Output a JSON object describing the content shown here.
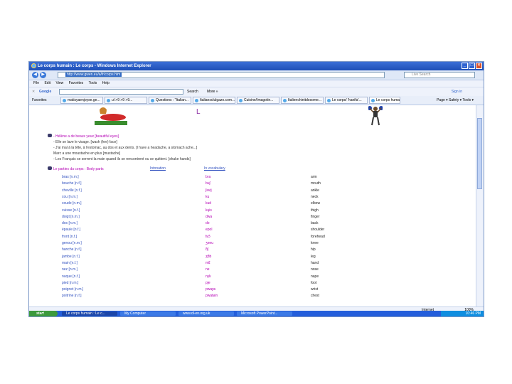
{
  "window": {
    "title": "Le corps humain : Le corps - Windows Internet Explorer",
    "address": "http://www.gwen.eu/a/fr/corps.htm",
    "search_placeholder": "Live Search"
  },
  "menu": [
    "File",
    "Edit",
    "View",
    "Favorites",
    "Tools",
    "Help"
  ],
  "google_bar": {
    "label": "Google",
    "search_label": "Search",
    "more_label": "More »",
    "sign_in": "Sign in"
  },
  "tabs_bar": {
    "favorites_label": "Favorites",
    "tabs": [
      "matisyaenjoyse.ge...",
      "ul >9 >9 >9...",
      "Questions : \"Italian...",
      "Italiansclulgazo.com...",
      "Cuisine/Imagotin...",
      "Italienchinitdosome...",
      "Le corps/ 'hanifa'...",
      "Le corps humain..."
    ],
    "tools": "Page ▾  Safety ▾  Tools ▾"
  },
  "page": {
    "letter": "L",
    "intro": [
      "- Hélène a de beaux yeux [beautiful eyes]",
      "- Elle se lave le visage. [wash (her) face]",
      "- J'ai mal à la tête, à l'estomac, au dos et aux dents. [I have a headache, a stomach ache...]",
      "Marc a une moustache en plus [mustache]",
      "- Les Français se serrent la main quand ils se rencontrent ou se quittent. [shake hands]"
    ],
    "section": {
      "title": "Le parties du corps : Body parts",
      "link1": "Intonation",
      "link2": "In vocabulary"
    },
    "table": [
      {
        "fr": "bras [n.m.]",
        "phon": "bra",
        "en": "arm"
      },
      {
        "fr": "bouche [n.f.]",
        "phon": "buʃ",
        "en": "mouth"
      },
      {
        "fr": "cheville [n.f.]",
        "phon": "ʃəvij",
        "en": "ankle"
      },
      {
        "fr": "cou [n.m.]",
        "phon": "ku",
        "en": "neck"
      },
      {
        "fr": "coude [n.m.]",
        "phon": "kud",
        "en": "elbow"
      },
      {
        "fr": "cuisse [n.f.]",
        "phon": "kɥis",
        "en": "thigh"
      },
      {
        "fr": "doigt [n.m.]",
        "phon": "dwa",
        "en": "finger"
      },
      {
        "fr": "dos [n.m.]",
        "phon": "do",
        "en": "back"
      },
      {
        "fr": "épaule [n.f.]",
        "phon": "epol",
        "en": "shoulder"
      },
      {
        "fr": "front [n.f.]",
        "phon": "fʁɔ̃",
        "en": "forehead"
      },
      {
        "fr": "genou [n.m.]",
        "phon": "ʒənu",
        "en": "knee"
      },
      {
        "fr": "hanche [n.f.]",
        "phon": "ɑ̃ʃ",
        "en": "hip"
      },
      {
        "fr": "jambe [n.f.]",
        "phon": "ʒɑ̃b",
        "en": "leg"
      },
      {
        "fr": "main [n.f.]",
        "phon": "mɛ̃",
        "en": "hand"
      },
      {
        "fr": "nez [n.m.]",
        "phon": "ne",
        "en": "nose"
      },
      {
        "fr": "nuque [n.f.]",
        "phon": "nyk",
        "en": "nape"
      },
      {
        "fr": "pied [n.m.]",
        "phon": "pje",
        "en": "foot"
      },
      {
        "fr": "poignet [n.m.]",
        "phon": "pwaɲɛ",
        "en": "wrist"
      },
      {
        "fr": "poitrine [n.f.]",
        "phon": "pwatʁin",
        "en": "chest"
      }
    ]
  },
  "status": {
    "zone": "Internet",
    "zoom": "100%"
  },
  "taskbar": {
    "start": "start",
    "items": [
      "Le corps humain : Le c...",
      "My Computer",
      "www.dl-en.org.uk",
      "Microsoft PowerPoint..."
    ],
    "clock": "10:46 PM"
  }
}
